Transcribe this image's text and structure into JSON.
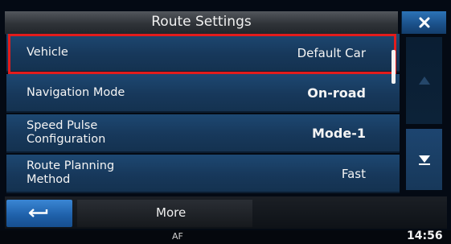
{
  "window": {
    "title": "Route Settings"
  },
  "settings": [
    {
      "label": "Vehicle",
      "value": "Default Car"
    },
    {
      "label": "Navigation Mode",
      "value": "On-road"
    },
    {
      "label": "Speed Pulse Configuration",
      "value": "Mode-1"
    },
    {
      "label": "Route Planning Method",
      "value": "Fast"
    }
  ],
  "selected_index": 0,
  "icons": {
    "close": "close-icon",
    "scroll_up": "triangle-up-icon",
    "scroll_down": "triangle-down-icon",
    "back": "return-arrow-icon"
  },
  "bottom": {
    "more_label": "More"
  },
  "status": {
    "af": "AF",
    "clock": "14:56"
  },
  "colors": {
    "highlight": "#e21c1c",
    "accent_blue": "#1e5fa8",
    "row_blue": "#1b426a"
  }
}
